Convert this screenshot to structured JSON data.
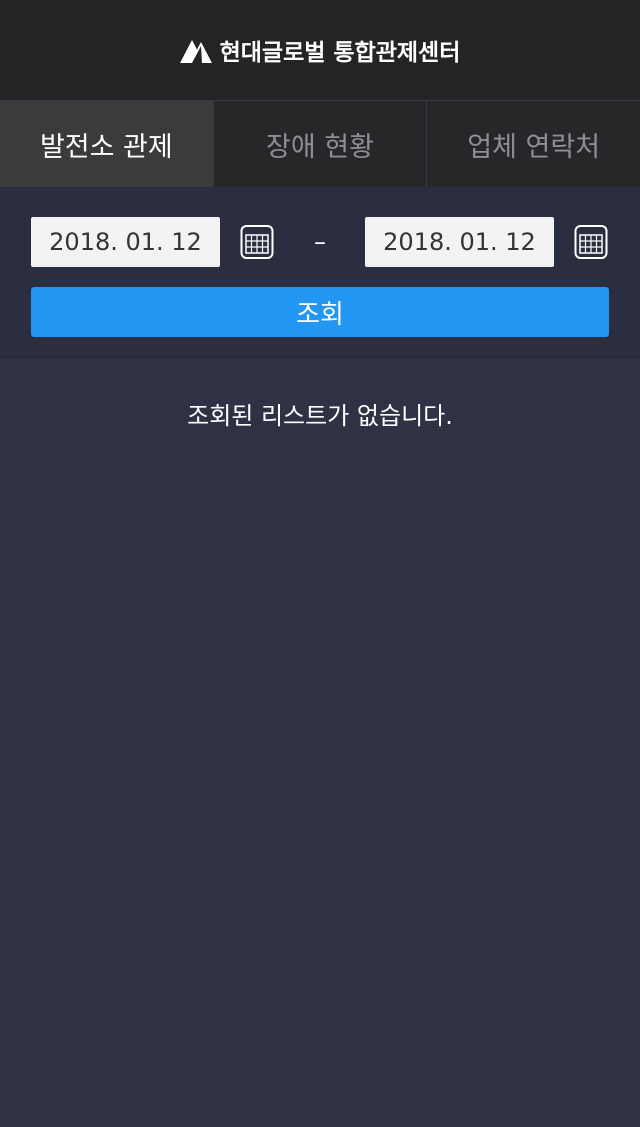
{
  "header": {
    "title": "현대글로벌 통합관제센터",
    "logo_icon": "triangle-mountain-logo"
  },
  "tabs": [
    {
      "label": "발전소 관제",
      "active": true
    },
    {
      "label": "장애 현황",
      "active": false
    },
    {
      "label": "업체 연락처",
      "active": false
    }
  ],
  "search": {
    "start_date": "2018. 01. 12",
    "end_date": "2018. 01. 12",
    "separator": "–",
    "calendar_icon": "calendar-icon",
    "button_label": "조회"
  },
  "result": {
    "empty_message": "조회된 리스트가 없습니다."
  },
  "colors": {
    "background": "#2f3244",
    "header": "#232426",
    "accent": "#2196f3"
  }
}
